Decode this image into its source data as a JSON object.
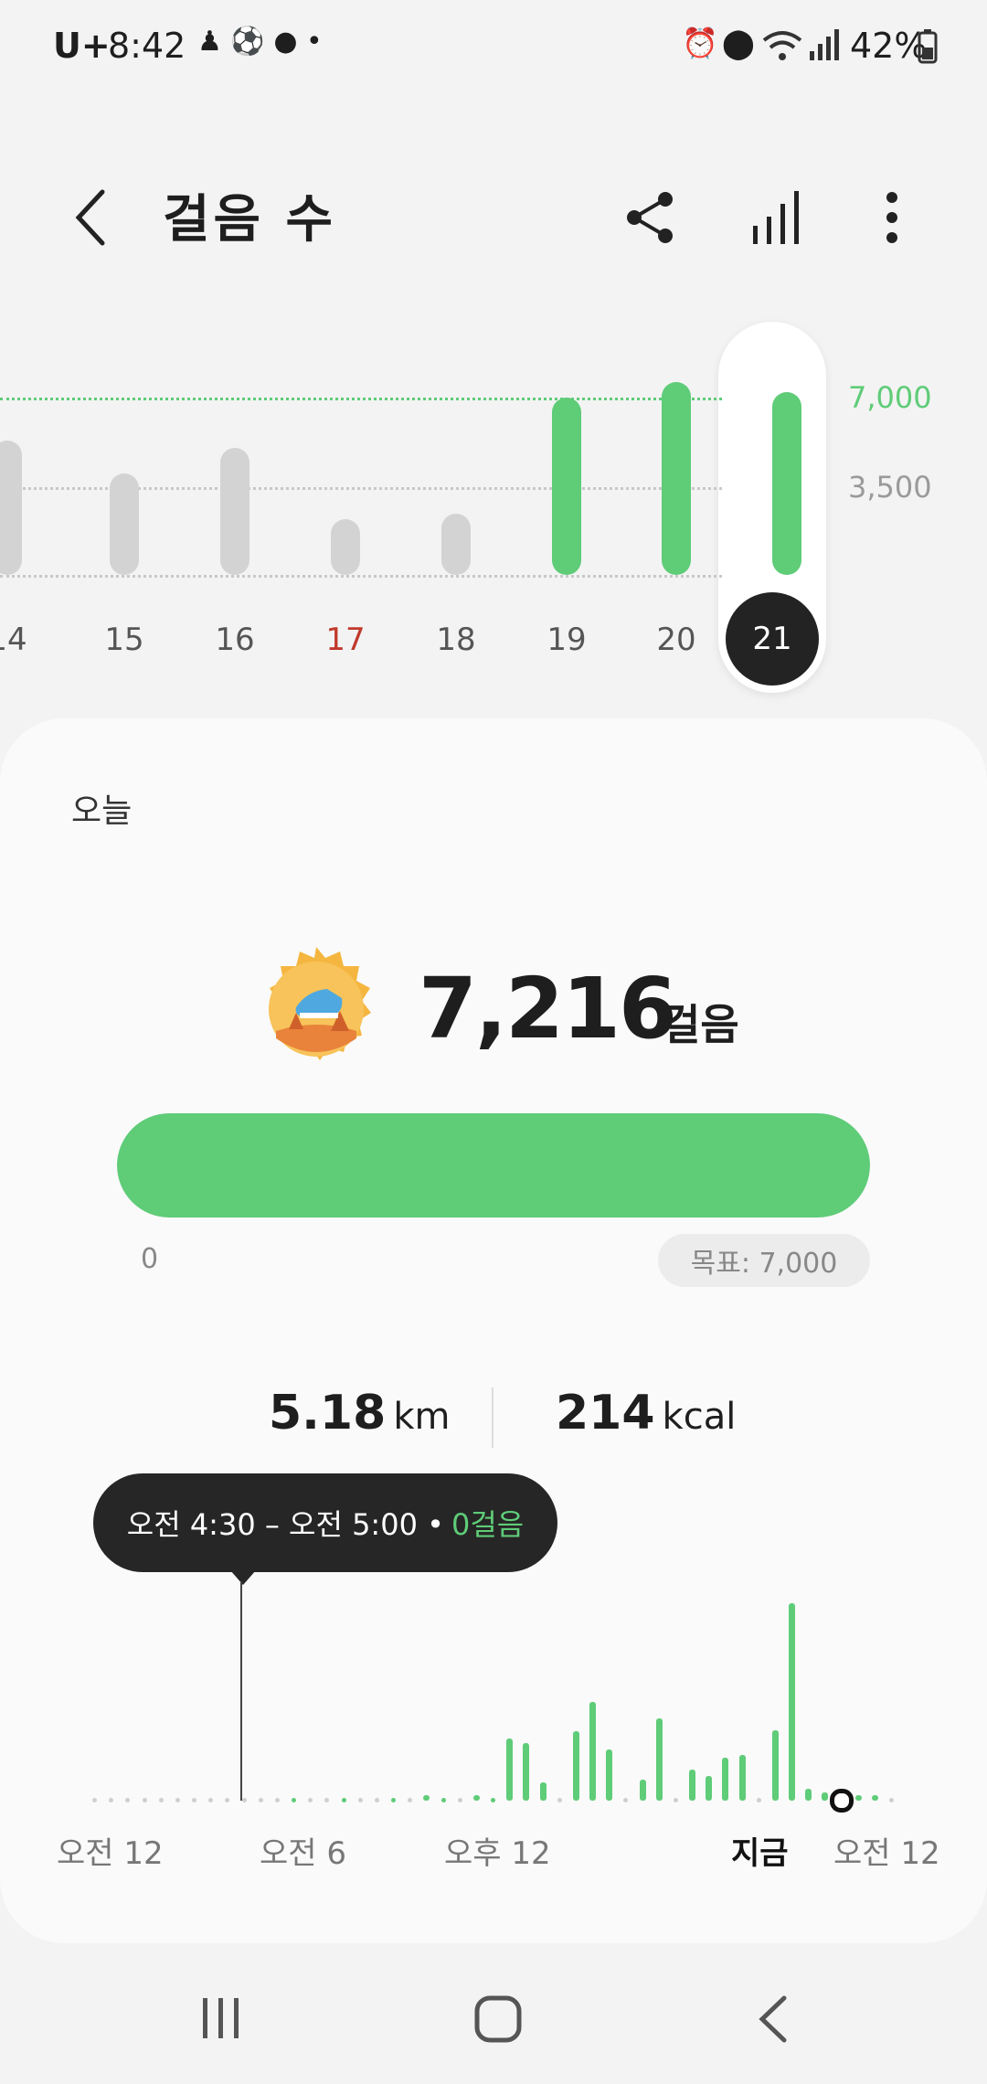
{
  "status_bar": {
    "carrier": "U+",
    "time": "8:42",
    "battery": "42%"
  },
  "header": {
    "title": "걸음 수"
  },
  "week_chart": {
    "goal_label": "7,000",
    "mid_label": "3,500",
    "days": [
      "14",
      "15",
      "16",
      "17",
      "18",
      "19",
      "20",
      "21"
    ],
    "selected_day": "21"
  },
  "summary": {
    "label": "오늘",
    "steps": "7,216",
    "steps_unit": "걸음",
    "progress_start": "0",
    "goal_chip": "목표: 7,000",
    "distance_value": "5.18",
    "distance_unit": "km",
    "calories_value": "214",
    "calories_unit": "kcal"
  },
  "tooltip": {
    "range": "오전 4:30 – 오전 5:00 •",
    "value": "0걸음"
  },
  "hourly_chart": {
    "labels": [
      "오전 12",
      "오전 6",
      "오후 12",
      "지금",
      "오전 12"
    ]
  },
  "chart_data": [
    {
      "type": "bar",
      "categories": [
        "14",
        "15",
        "16",
        "17",
        "18",
        "19",
        "20",
        "21"
      ],
      "values": [
        5300,
        4000,
        5000,
        2200,
        2400,
        7000,
        7600,
        7216
      ],
      "yticks": [
        "3,500",
        "7,000"
      ],
      "goal": 7000,
      "selected": "21",
      "grid": true
    },
    {
      "type": "bar",
      "x_labels": [
        "오전 12",
        "오전 6",
        "오후 12",
        "지금",
        "오전 12"
      ],
      "values": [
        0,
        0,
        0,
        0,
        0,
        0,
        0,
        0,
        0,
        0,
        0,
        0,
        0,
        0,
        0,
        0,
        0,
        0,
        0,
        0,
        1,
        0,
        0,
        2,
        0,
        380,
        350,
        110,
        0,
        420,
        600,
        310,
        0,
        130,
        500,
        0,
        190,
        150,
        260,
        280,
        0,
        430,
        1200,
        70,
        50,
        0,
        30,
        30,
        0
      ],
      "selected_index": 9,
      "selected_value": "0걸음"
    }
  ],
  "colors": {
    "accent_green": "#5fcc78",
    "inactive_bar": "#d3d3d3",
    "sunday_red": "#c0392b"
  },
  "icons": [
    "back-arrow-icon",
    "share-icon",
    "bar-chart-icon",
    "more-icon",
    "recents-icon",
    "home-icon",
    "back-icon"
  ]
}
